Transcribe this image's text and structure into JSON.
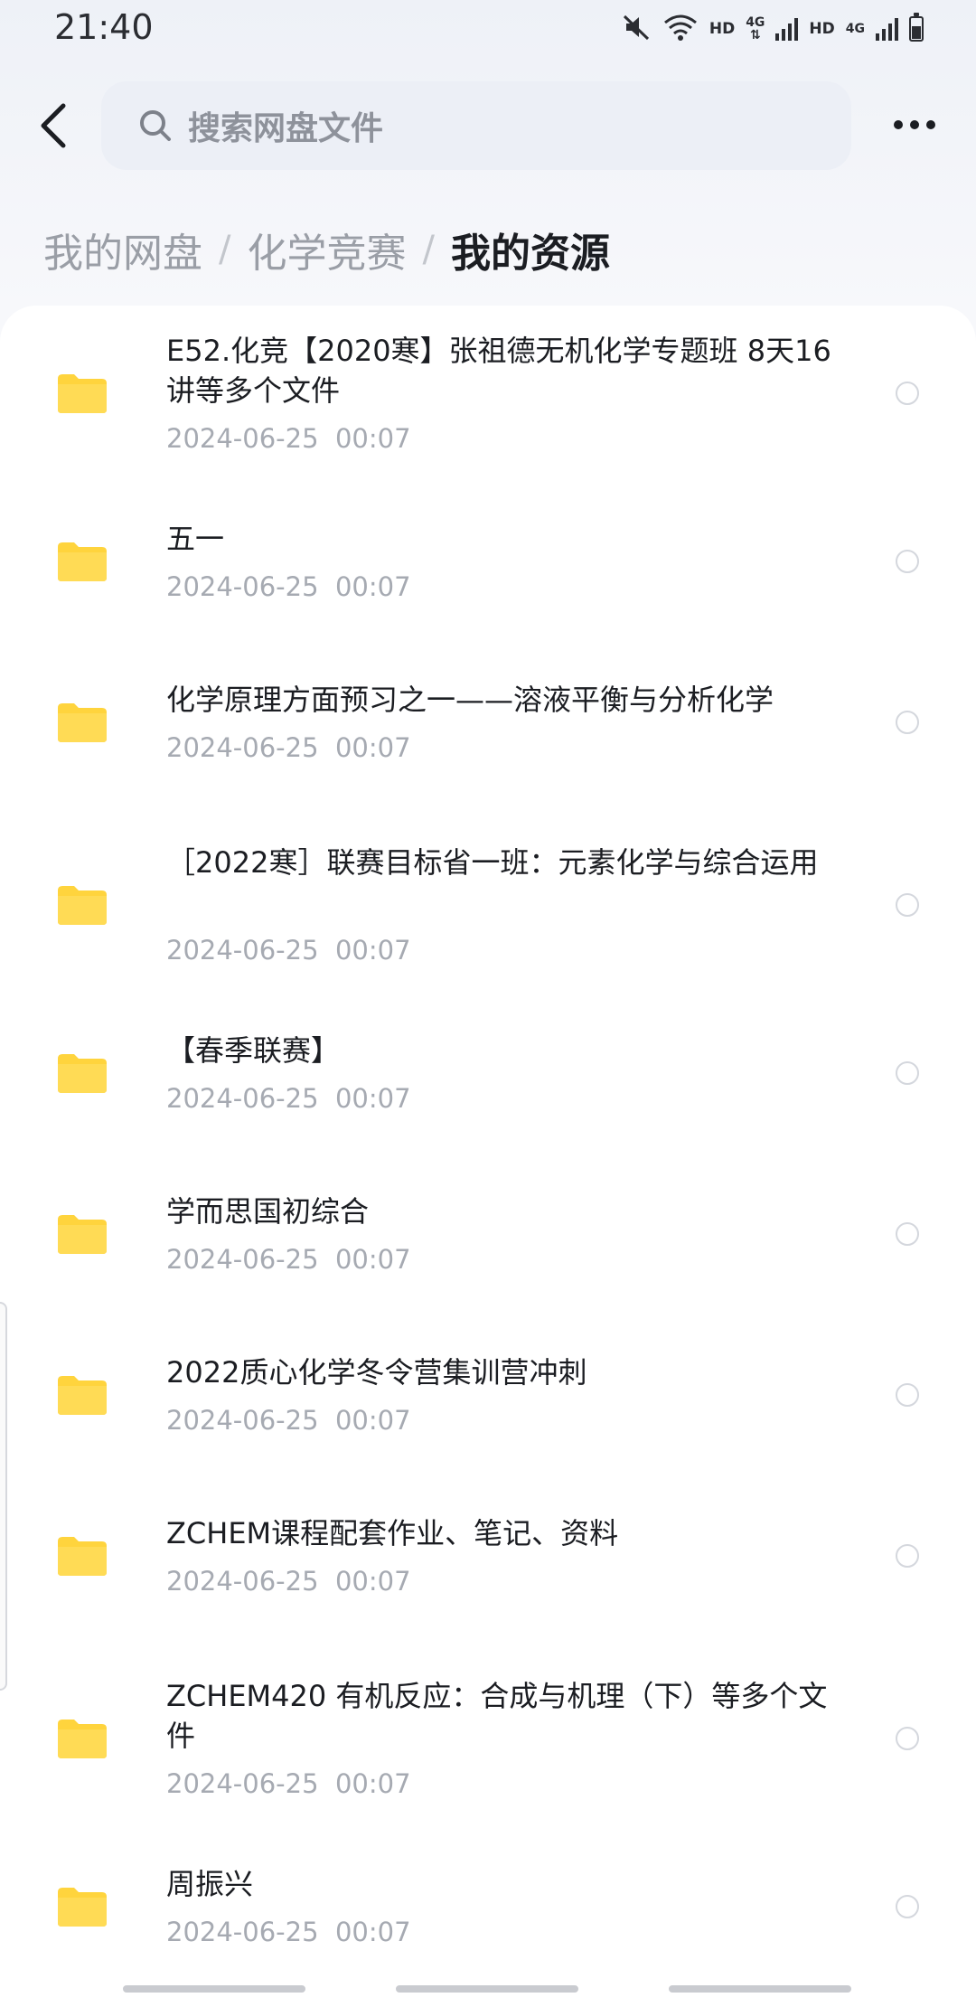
{
  "status_bar": {
    "time": "21:40",
    "hd1": "HD",
    "net1": "4G",
    "hd2": "HD",
    "net2": "4G",
    "icons": [
      "mute-icon",
      "wifi-icon",
      "signal-icon",
      "battery-icon"
    ]
  },
  "header": {
    "search_placeholder": "搜索网盘文件",
    "icons": [
      "back-arrow-icon",
      "search-icon",
      "more-dots-icon"
    ]
  },
  "breadcrumb": {
    "items": [
      "我的网盘",
      "化学竞赛",
      "我的资源"
    ],
    "separator": "/"
  },
  "files": [
    {
      "name": "E52.化竞【2020寒】张祖德无机化学专题班 8天16讲等多个文件",
      "date": "2024-06-25  00:07",
      "icon": "folder-icon"
    },
    {
      "name": "五一",
      "date": "2024-06-25  00:07",
      "icon": "folder-icon"
    },
    {
      "name": "化学原理方面预习之一——溶液平衡与分析化学",
      "date": "2024-06-25  00:07",
      "icon": "folder-icon"
    },
    {
      "name": "［2022寒］联赛目标省一班：元素化学与综合运用",
      "date": "2024-06-25  00:07",
      "icon": "folder-icon"
    },
    {
      "name": "【春季联赛】",
      "date": "2024-06-25  00:07",
      "icon": "folder-icon"
    },
    {
      "name": "学而思国初综合",
      "date": "2024-06-25  00:07",
      "icon": "folder-icon"
    },
    {
      "name": "2022质心化学冬令营集训营冲刺",
      "date": "2024-06-25  00:07",
      "icon": "folder-icon"
    },
    {
      "name": "ZCHEM课程配套作业、笔记、资料",
      "date": "2024-06-25  00:07",
      "icon": "folder-icon"
    },
    {
      "name": "ZCHEM420 有机反应：合成与机理（下）等多个文件",
      "date": "2024-06-25  00:07",
      "icon": "folder-icon"
    },
    {
      "name": "周振兴",
      "date": "2024-06-25  00:07",
      "icon": "folder-icon"
    }
  ],
  "colors": {
    "folder": "#FFD43D",
    "accent_text": "#1b1d22",
    "muted_text": "#a6aab2",
    "search_bg": "#eceff6"
  }
}
